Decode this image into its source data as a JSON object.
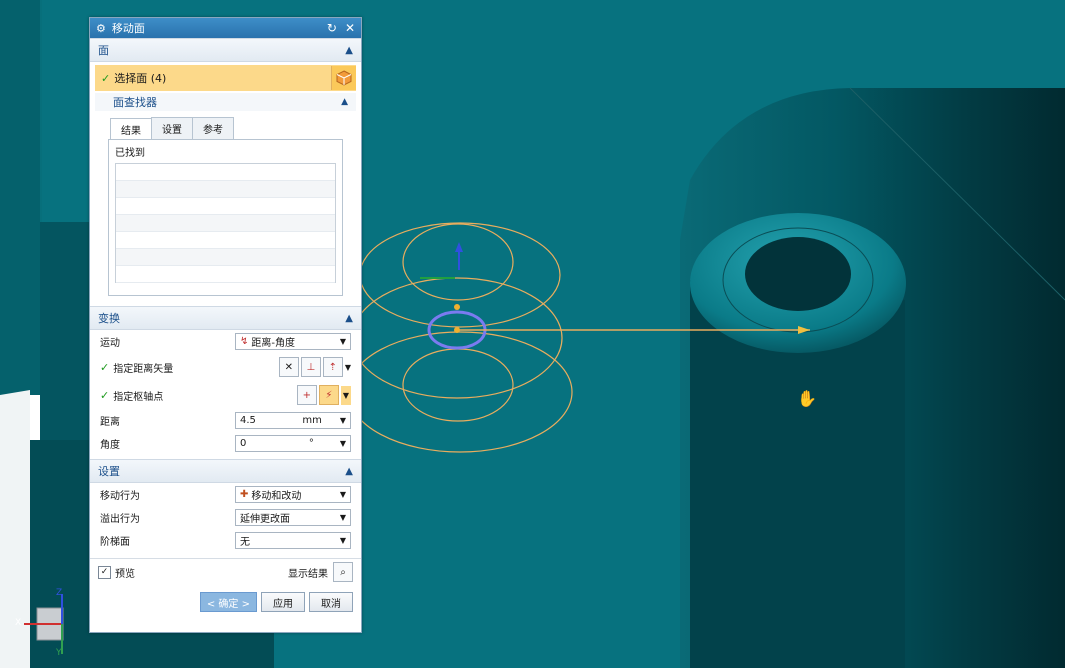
{
  "dialog": {
    "title": "移动面",
    "face_section": {
      "label": "面",
      "select_face": "选择面 (4)"
    },
    "face_finder": {
      "label": "面查找器",
      "tabs": [
        "结果",
        "设置",
        "参考"
      ],
      "found_label": "已找到"
    },
    "transform": {
      "label": "变换",
      "motion_label": "运动",
      "motion_value": "距离-角度",
      "distance_vector": "指定距离矢量",
      "pivot_point": "指定枢轴点",
      "distance_label": "距离",
      "distance_value": "4.5",
      "distance_unit": "mm",
      "angle_label": "角度",
      "angle_value": "0",
      "angle_unit": "°"
    },
    "settings": {
      "label": "设置",
      "move_behavior_label": "移动行为",
      "move_behavior_value": "移动和改动",
      "overflow_label": "溢出行为",
      "overflow_value": "延伸更改面",
      "step_label": "阶梯面",
      "step_value": "无"
    },
    "preview": {
      "label": "预览",
      "show_result": "显示结果"
    },
    "buttons": {
      "ok": "< 确定 >",
      "apply": "应用",
      "cancel": "取消"
    }
  },
  "triad": {
    "x": "X",
    "y": "Y",
    "z": "Z"
  },
  "colors": {
    "viewport_bg": "#07727f",
    "highlight": "#fcd98a",
    "accent": "#2a72ad"
  }
}
